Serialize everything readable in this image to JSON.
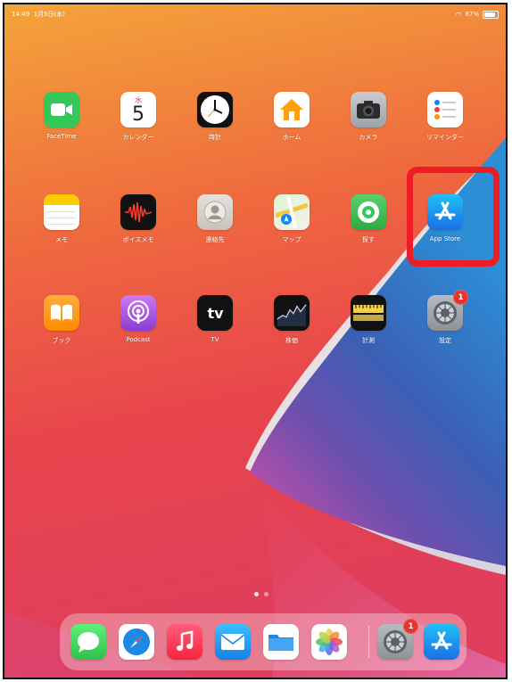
{
  "status_bar": {
    "time": "14:49",
    "date": "1月5日(水)",
    "battery": "87%"
  },
  "home_apps": [
    {
      "id": "facetime",
      "label": "FaceTime",
      "icon": "video-camera-icon",
      "color": "#34c759"
    },
    {
      "id": "calendar",
      "label": "カレンダー",
      "icon": "calendar-icon",
      "day_name": "水",
      "day_number": "5"
    },
    {
      "id": "clock",
      "label": "時計",
      "icon": "clock-icon"
    },
    {
      "id": "home",
      "label": "ホーム",
      "icon": "house-icon",
      "color": "#ff9f0a"
    },
    {
      "id": "camera",
      "label": "カメラ",
      "icon": "camera-icon"
    },
    {
      "id": "reminders",
      "label": "リマインダー",
      "icon": "reminders-list-icon"
    },
    {
      "id": "notes",
      "label": "メモ",
      "icon": "notes-icon"
    },
    {
      "id": "voicememos",
      "label": "ボイスメモ",
      "icon": "waveform-icon"
    },
    {
      "id": "contacts",
      "label": "連絡先",
      "icon": "contacts-icon"
    },
    {
      "id": "maps",
      "label": "マップ",
      "icon": "map-icon"
    },
    {
      "id": "findmy",
      "label": "探す",
      "icon": "find-my-icon"
    },
    {
      "id": "appstore",
      "label": "App Store",
      "icon": "app-store-icon",
      "color": "#1e8cf0"
    },
    {
      "id": "books",
      "label": "ブック",
      "icon": "book-icon",
      "color": "#ff9500"
    },
    {
      "id": "podcasts",
      "label": "Podcast",
      "icon": "podcast-icon",
      "color": "#a34ae0"
    },
    {
      "id": "tv",
      "label": "TV",
      "icon": "apple-tv-icon",
      "text": "tv"
    },
    {
      "id": "stocks",
      "label": "株価",
      "icon": "stocks-chart-icon"
    },
    {
      "id": "measure",
      "label": "計測",
      "icon": "ruler-icon"
    },
    {
      "id": "settings",
      "label": "設定",
      "icon": "gear-icon",
      "badge": "1"
    }
  ],
  "page_indicator": {
    "total": 2,
    "current": 1
  },
  "dock": [
    {
      "id": "messages",
      "icon": "speech-bubble-icon"
    },
    {
      "id": "safari",
      "icon": "compass-icon"
    },
    {
      "id": "music",
      "icon": "music-note-icon"
    },
    {
      "id": "mail",
      "icon": "envelope-icon"
    },
    {
      "id": "files",
      "icon": "folder-icon"
    },
    {
      "id": "photos",
      "icon": "photos-flower-icon"
    },
    {
      "id": "settings",
      "icon": "gear-icon",
      "badge": "1"
    },
    {
      "id": "appstore",
      "icon": "app-store-icon"
    }
  ],
  "highlight": {
    "target": "appstore",
    "color": "#ee1c25"
  }
}
